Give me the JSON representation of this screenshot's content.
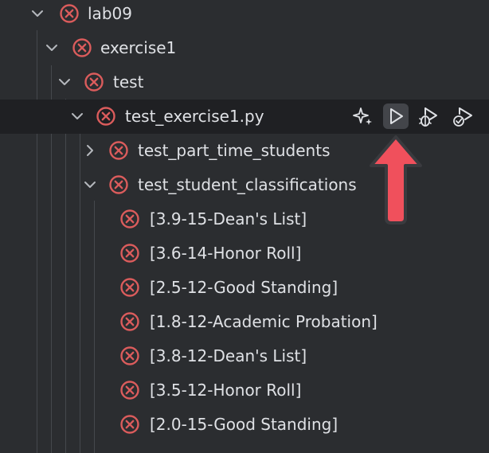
{
  "tree": {
    "nodes": [
      {
        "label": "lab09",
        "expanded": true,
        "status": "failed"
      },
      {
        "label": "exercise1",
        "expanded": true,
        "status": "failed"
      },
      {
        "label": "test",
        "expanded": true,
        "status": "failed"
      },
      {
        "label": "test_exercise1.py",
        "expanded": true,
        "status": "failed",
        "selected": true
      },
      {
        "label": "test_part_time_students",
        "expanded": false,
        "status": "failed"
      },
      {
        "label": "test_student_classifications",
        "expanded": true,
        "status": "failed"
      },
      {
        "label": "[3.9-15-Dean's List]",
        "status": "failed"
      },
      {
        "label": "[3.6-14-Honor Roll]",
        "status": "failed"
      },
      {
        "label": "[2.5-12-Good Standing]",
        "status": "failed"
      },
      {
        "label": "[1.8-12-Academic Probation]",
        "status": "failed"
      },
      {
        "label": "[3.8-12-Dean's List]",
        "status": "failed"
      },
      {
        "label": "[3.5-12-Honor Roll]",
        "status": "failed"
      },
      {
        "label": "[2.0-15-Good Standing]",
        "status": "failed"
      }
    ]
  },
  "row_actions": {
    "items": [
      {
        "icon": "sparkle-icon"
      },
      {
        "icon": "run-icon",
        "hovered": true
      },
      {
        "icon": "debug-icon"
      },
      {
        "icon": "run-with-coverage-icon"
      }
    ]
  },
  "colors": {
    "background": "#2b2d30",
    "selected_row": "#1f2023",
    "fail_red": "#db5c5c",
    "text": "#dfe1e5",
    "callout_arrow": "#f0505c"
  }
}
